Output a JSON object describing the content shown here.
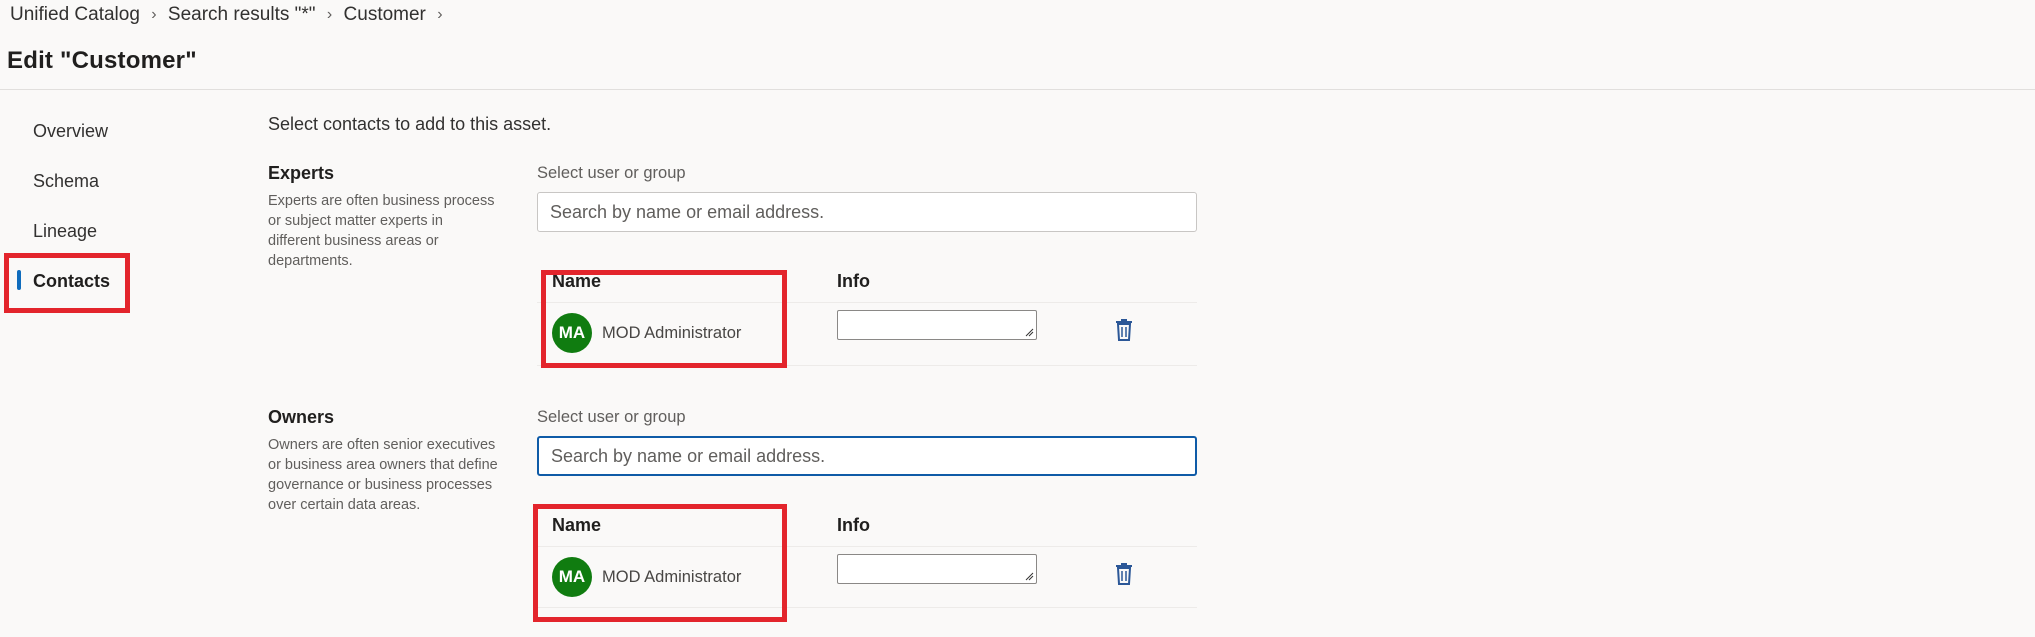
{
  "breadcrumb": [
    {
      "label": "Unified Catalog"
    },
    {
      "label": "Search results \"*\""
    },
    {
      "label": "Customer"
    }
  ],
  "page": {
    "title": "Edit \"Customer\""
  },
  "nav": {
    "items": [
      {
        "label": "Overview",
        "active": false
      },
      {
        "label": "Schema",
        "active": false
      },
      {
        "label": "Lineage",
        "active": false
      },
      {
        "label": "Contacts",
        "active": true
      }
    ]
  },
  "main": {
    "intro": "Select contacts to add to this asset.",
    "sections": [
      {
        "title": "Experts",
        "description": "Experts are often business process or subject matter experts in different business areas or departments.",
        "select_label": "Select user or group",
        "search_placeholder": "Search by name or email address.",
        "columns": {
          "name": "Name",
          "info": "Info"
        },
        "contacts": [
          {
            "initials": "MA",
            "name": "MOD Administrator",
            "info": ""
          }
        ]
      },
      {
        "title": "Owners",
        "description": "Owners are often senior executives or business area owners that define governance or business processes over certain data areas.",
        "select_label": "Select user or group",
        "search_placeholder": "Search by name or email address.",
        "columns": {
          "name": "Name",
          "info": "Info"
        },
        "contacts": [
          {
            "initials": "MA",
            "name": "MOD Administrator",
            "info": ""
          }
        ]
      }
    ]
  },
  "colors": {
    "avatar": "#107c10",
    "accent": "#0f6cbd",
    "highlight": "#e3252c",
    "delete_icon": "#2b5797"
  },
  "icons": {
    "breadcrumb_separator": "chevron-right-icon",
    "delete": "trash-icon",
    "resize": "resize-grip-icon"
  }
}
